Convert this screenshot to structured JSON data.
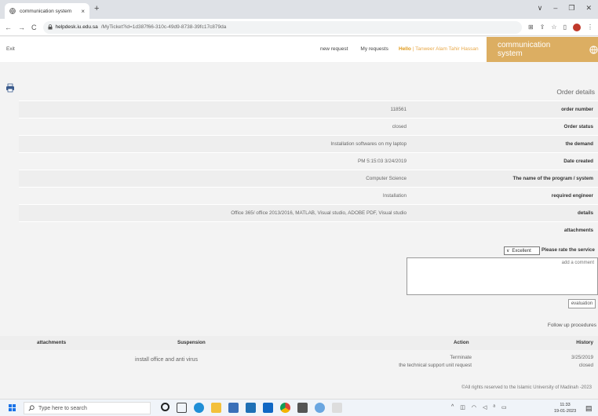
{
  "browser": {
    "tab_title": "communication system",
    "tab_close": "×",
    "new_tab": "+",
    "url_host": "helpdesk.iu.edu.sa",
    "url_path": "/MyTicket?id=1d387f66-310c-49d9-8738-39fc17c879da",
    "win_min": "–",
    "win_max": "❐",
    "win_close": "✕",
    "win_down": "∨"
  },
  "nav": {
    "exit": "Exit",
    "new_request": "new request",
    "my_requests": "My requests",
    "hello": "Hello",
    "user_name": "Tanweer Alam Tahir Hassan",
    "brand": "communication system"
  },
  "order": {
    "title": "Order details",
    "rows": [
      {
        "value": "118561",
        "label": "order number"
      },
      {
        "value": "closed",
        "label": "Order status"
      },
      {
        "value": "Installation softwares on my laptop",
        "label": "the demand"
      },
      {
        "value": "PM 5:15:03 3/24/2019",
        "label": "Date created"
      },
      {
        "value": "Computer Science",
        "label": "The name of the program / system"
      },
      {
        "value": "Installation",
        "label": "required engineer"
      },
      {
        "value": "Office 365/ office 2013/2016, MATLAB, Visual studio, ADOBE PDF, Visual studio",
        "label": "details"
      },
      {
        "value": "",
        "label": "attachments"
      }
    ]
  },
  "rating": {
    "selected": "Excellent",
    "label": "Please rate the service",
    "comment_placeholder": "add a comment",
    "evaluate_btn": "evaluation"
  },
  "followup": {
    "title": "Follow up procedures",
    "headers": {
      "attachments": "attachments",
      "suspension": "Suspension",
      "action": "Action",
      "history": "History"
    },
    "rows": [
      {
        "suspension": "install office and anti virus",
        "action": "Terminate",
        "action_sub": "the technical support unit request",
        "history": "3/25/2019",
        "history_sub": "closed"
      }
    ]
  },
  "footer": "©All rights reserved to the Islamic University of Madinah -2023",
  "taskbar": {
    "search_placeholder": "Type here to search",
    "time": "11:33",
    "date": "19-01-2023"
  }
}
